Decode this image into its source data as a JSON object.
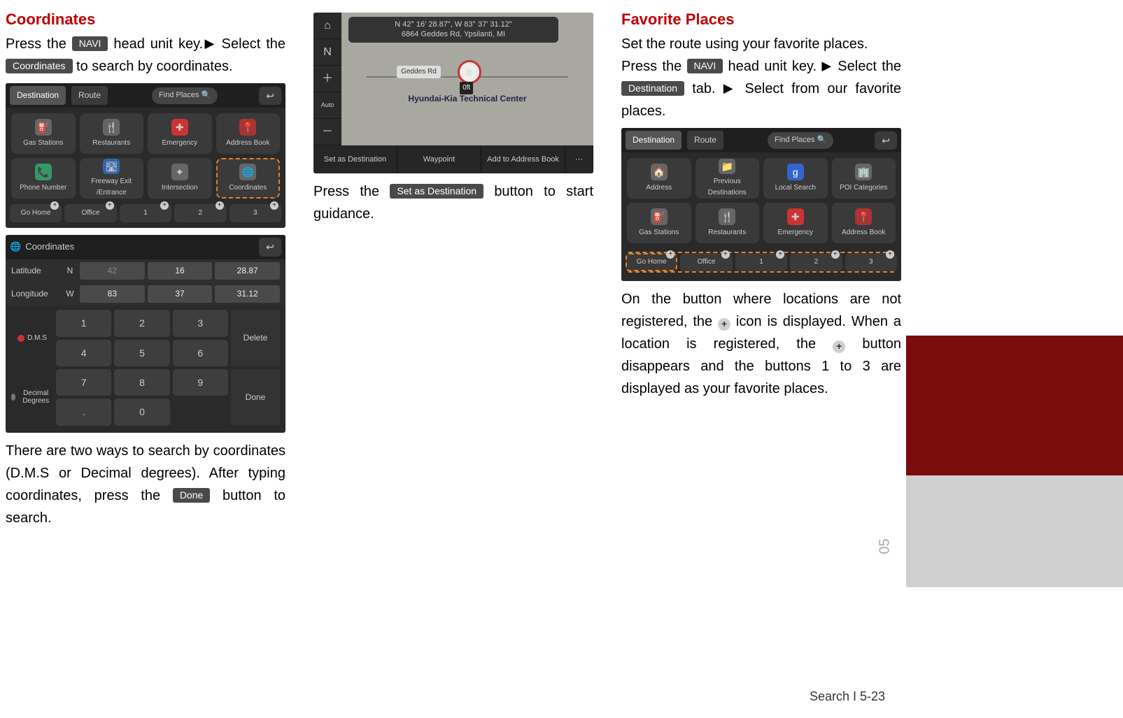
{
  "col1": {
    "heading": "Coordinates",
    "p1a": "Press the ",
    "key_navi": "NAVI",
    "p1b": " head unit key.",
    "arrow": "▶",
    "p1c": " Select the ",
    "key_coord": "Coordinates",
    "p1d": " to search by coordinates.",
    "shot1": {
      "tab_dest": "Destination",
      "tab_route": "Route",
      "search": "Find Places",
      "tiles": [
        "Gas Stations",
        "Restaurants",
        "Emergency",
        "Address Book",
        "Phone Number",
        "Freeway Exit /Entrance",
        "Intersection",
        "Coordinates"
      ],
      "fav": [
        "Go Home",
        "Office",
        "1",
        "2",
        "3"
      ]
    },
    "shot2": {
      "title": "Coordinates",
      "lat_label": "Latitude",
      "lat_dir": "N",
      "lat_d": "42",
      "lat_m": "16",
      "lat_s": "28.87",
      "lon_label": "Longitude",
      "lon_dir": "W",
      "lon_d": "83",
      "lon_m": "37",
      "lon_s": "31.12",
      "mode_dms": "D.M.S",
      "mode_dec": "Decimal Degrees",
      "keys": [
        "1",
        "2",
        "3",
        "4",
        "5",
        "6",
        "7",
        "8",
        "9",
        ".",
        "0"
      ],
      "delete": "Delete",
      "done": "Done"
    },
    "p2a": "There are two ways to search by coordinates (D.M.S or Decimal degrees). After typing coordinates, press the ",
    "key_done": "Done",
    "p2b": " button to search."
  },
  "col2": {
    "map": {
      "coords_line": "N  42° 16' 28.87\", W  83° 37' 31.12\"",
      "addr": "6864 Geddes Rd, Ypsilanti, MI",
      "road": "Geddes Rd",
      "center": "Hyundai-Kia Technical Center",
      "dist": "0ft",
      "btn_set": "Set as Destination",
      "btn_wp": "Waypoint",
      "btn_add": "Add to Address Book"
    },
    "p1a": "Press the ",
    "key_set": "Set as Destination",
    "p1b": " button to start guidance."
  },
  "col3": {
    "heading": "Favorite Places",
    "p1": "Set the route using your favorite places.",
    "p2a": "Press the ",
    "key_navi": "NAVI",
    "p2b": " head unit key. ",
    "arrow": "▶",
    "p2c": " Select the ",
    "key_dest": "Destination",
    "p2d": " tab. ",
    "p2e": " Select from our favorite places.",
    "shot": {
      "tab_dest": "Destination",
      "tab_route": "Route",
      "search": "Find Places",
      "tiles": [
        "Address",
        "Previous Destinations",
        "Local Search",
        "POI Categories",
        "Gas Stations",
        "Restaurants",
        "Emergency",
        "Address Book"
      ],
      "fav": [
        "Go Home",
        "Office",
        "1",
        "2",
        "3"
      ]
    },
    "p3a": "On the button where locations are not registered, the ",
    "plus": "+",
    "p3b": " icon is displayed. When a location is registered, the ",
    "p3c": " button disappears and the buttons 1 to 3 are displayed as your favorite places."
  },
  "sidetab": "05",
  "footer": "Search I 5-23"
}
